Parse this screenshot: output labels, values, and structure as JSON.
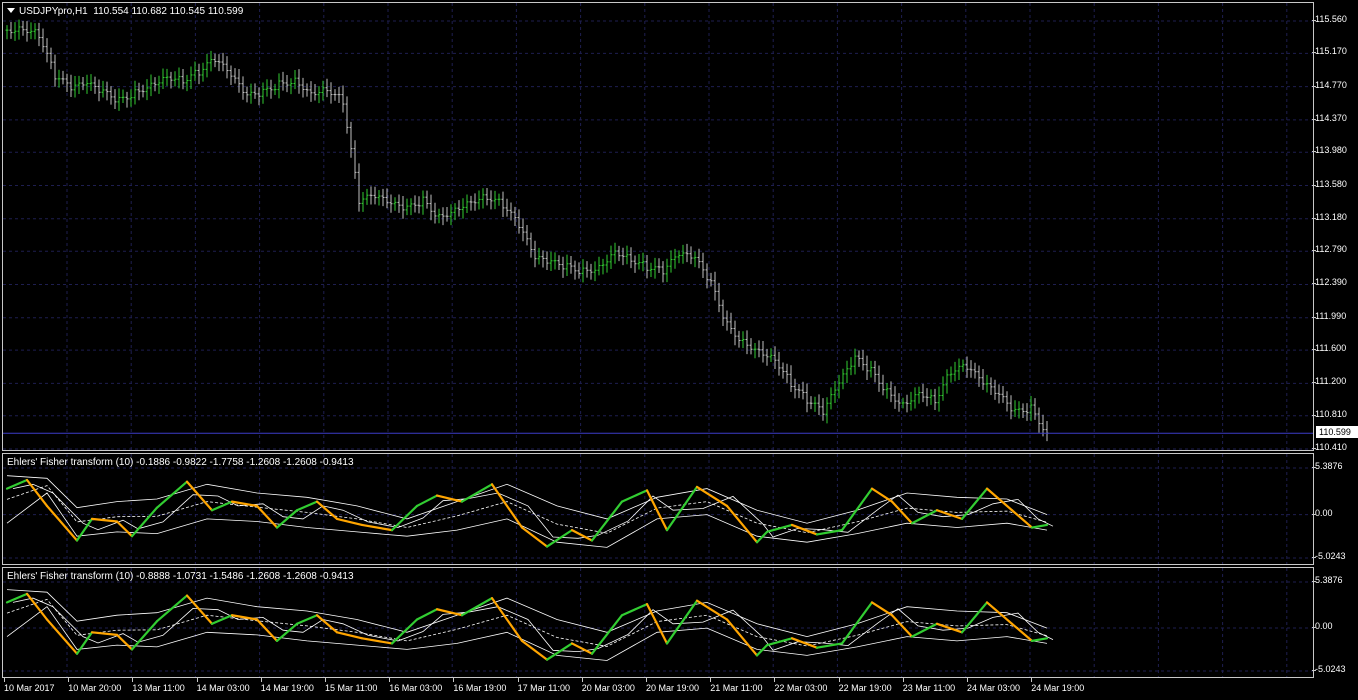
{
  "main_pane": {
    "title": "USDJPYpro,H1",
    "ohlc": "110.554 110.682 110.545 110.599",
    "price_ticks": [
      "115.560",
      "115.170",
      "114.770",
      "114.370",
      "113.980",
      "113.580",
      "113.180",
      "112.790",
      "112.390",
      "111.990",
      "111.600",
      "111.200",
      "110.810",
      "110.410"
    ],
    "current_price": "110.599",
    "colors": {
      "bull": "#32cd32",
      "bear": "#c0c0c0",
      "grid": "#1e1e50",
      "current_line": "#3c3cc8"
    }
  },
  "indicator_1": {
    "title": "Ehlers' Fisher transform (10) -0.1886 -0.9822 -1.7758 -1.2608 -1.2608 -0.9413",
    "scale": [
      "5.3876",
      "0.00",
      "-5.0243"
    ],
    "colors": {
      "rising": "#32cd32",
      "falling": "#ffa500",
      "bands": "#ffffff"
    }
  },
  "indicator_2": {
    "title": "Ehlers' Fisher transform (10) -0.8888 -1.0731 -1.5486 -1.2608 -1.2608 -0.9413",
    "scale": [
      "5.3876",
      "0.00",
      "-5.0243"
    ],
    "colors": {
      "rising": "#32cd32",
      "falling": "#ffa500",
      "bands": "#ffffff"
    }
  },
  "time_axis": {
    "labels": [
      "10 Mar 2017",
      "10 Mar 20:00",
      "13 Mar 11:00",
      "14 Mar 03:00",
      "14 Mar 19:00",
      "15 Mar 11:00",
      "16 Mar 03:00",
      "16 Mar 19:00",
      "17 Mar 11:00",
      "20 Mar 03:00",
      "20 Mar 19:00",
      "21 Mar 11:00",
      "22 Mar 03:00",
      "22 Mar 19:00",
      "23 Mar 11:00",
      "24 Mar 03:00",
      "24 Mar 19:00"
    ]
  },
  "chart_data": [
    {
      "type": "line",
      "title": "USDJPYpro,H1",
      "ylim": [
        110.41,
        115.56
      ],
      "series": [
        {
          "name": "USDJPYpro,H1",
          "x": [
            0,
            16,
            32,
            48,
            64,
            80,
            96,
            112,
            128,
            144,
            160,
            176,
            192,
            208,
            224,
            240,
            256,
            272,
            288,
            304,
            320,
            336,
            352,
            368,
            384,
            400,
            416,
            432,
            448,
            464,
            480,
            496,
            512,
            528,
            544,
            560,
            576,
            592,
            608,
            624,
            640,
            656,
            672,
            688,
            704,
            720,
            736,
            752,
            768,
            784,
            800,
            816,
            832,
            848,
            864,
            880,
            896,
            912,
            928,
            944,
            960,
            976,
            992,
            1008,
            1024,
            1040
          ],
          "values": [
            115.45,
            115.48,
            115.4,
            114.9,
            114.75,
            114.8,
            114.7,
            114.6,
            114.7,
            114.8,
            114.9,
            114.85,
            114.95,
            115.1,
            114.9,
            114.65,
            114.7,
            114.8,
            114.85,
            114.7,
            114.75,
            114.6,
            113.4,
            113.45,
            113.35,
            113.3,
            113.4,
            113.2,
            113.3,
            113.4,
            113.45,
            113.35,
            113.1,
            112.7,
            112.65,
            112.6,
            112.55,
            112.6,
            112.8,
            112.7,
            112.6,
            112.55,
            112.75,
            112.7,
            112.4,
            111.9,
            111.7,
            111.6,
            111.5,
            111.2,
            111.0,
            110.85,
            111.2,
            111.5,
            111.35,
            111.1,
            110.95,
            111.1,
            111.0,
            111.35,
            111.4,
            111.2,
            111.05,
            110.85,
            110.9,
            110.6
          ]
        }
      ]
    },
    {
      "type": "line",
      "title": "Ehlers' Fisher transform (10) -0.1886 -0.9822 -1.7758 -1.2608 -1.2608 -0.9413",
      "ylim": [
        -5.0243,
        5.3876
      ],
      "series": [
        {
          "x": [
            0,
            20,
            40,
            70,
            85,
            110,
            125,
            150,
            180,
            205,
            225,
            250,
            270,
            290,
            310,
            330,
            355,
            385,
            410,
            430,
            455,
            485,
            515,
            540,
            565,
            585,
            615,
            640,
            660,
            690,
            720,
            750,
            760,
            785,
            810,
            835,
            865,
            885,
            905,
            930,
            955,
            980,
            1005,
            1025,
            1040
          ],
          "values": [
            3.0,
            4.0,
            1.0,
            -3.0,
            -0.5,
            -0.8,
            -2.5,
            0.8,
            3.8,
            0.5,
            1.5,
            1.0,
            -1.5,
            0.5,
            1.5,
            -0.5,
            -1.2,
            -1.8,
            1.0,
            2.2,
            1.5,
            3.5,
            -1.5,
            -3.7,
            -1.8,
            -3.0,
            1.5,
            2.8,
            -1.8,
            3.2,
            1.0,
            -3.2,
            -2.0,
            -1.2,
            -2.3,
            -1.8,
            3.0,
            1.5,
            -1.0,
            0.5,
            -0.5,
            3.0,
            0.5,
            -1.5,
            -1.2
          ]
        },
        {
          "x": [
            0,
            40,
            70,
            110,
            150,
            200,
            250,
            300,
            350,
            400,
            450,
            500,
            550,
            600,
            650,
            700,
            750,
            800,
            850,
            900,
            950,
            1000,
            1040
          ],
          "values": [
            4.5,
            4.2,
            0.8,
            1.5,
            1.8,
            3.5,
            2.5,
            2.0,
            1.0,
            -0.5,
            1.5,
            3.5,
            1.0,
            -0.5,
            2.0,
            3.0,
            0.5,
            -1.0,
            0.5,
            2.5,
            2.0,
            1.8,
            0.0
          ]
        },
        {
          "x": [
            0,
            40,
            70,
            110,
            150,
            200,
            250,
            300,
            350,
            400,
            450,
            500,
            550,
            600,
            650,
            700,
            750,
            800,
            850,
            900,
            950,
            1000,
            1040
          ],
          "values": [
            -1.0,
            2.5,
            -2.5,
            -2.0,
            -2.2,
            -0.5,
            -0.8,
            -1.5,
            -2.0,
            -2.5,
            -1.8,
            -0.5,
            -3.2,
            -3.8,
            -0.5,
            0.0,
            -2.5,
            -3.2,
            -2.2,
            -1.0,
            -1.5,
            -1.0,
            -1.8
          ]
        }
      ]
    },
    {
      "type": "line",
      "title": "Ehlers' Fisher transform (10) -0.8888 -1.0731 -1.5486 -1.2608 -1.2608 -0.9413",
      "ylim": [
        -5.0243,
        5.3876
      ],
      "series": [
        {
          "x": [
            0,
            20,
            40,
            70,
            85,
            110,
            125,
            150,
            180,
            205,
            225,
            250,
            270,
            290,
            310,
            330,
            355,
            385,
            410,
            430,
            455,
            485,
            515,
            540,
            565,
            585,
            615,
            640,
            660,
            690,
            720,
            750,
            760,
            785,
            810,
            835,
            865,
            885,
            905,
            930,
            955,
            980,
            1005,
            1025,
            1040
          ],
          "values": [
            3.0,
            4.0,
            1.0,
            -3.0,
            -0.5,
            -0.8,
            -2.5,
            0.8,
            3.8,
            0.5,
            1.5,
            1.0,
            -1.5,
            0.5,
            1.5,
            -0.5,
            -1.2,
            -1.8,
            1.0,
            2.2,
            1.5,
            3.5,
            -1.5,
            -3.7,
            -1.8,
            -3.0,
            1.5,
            2.8,
            -1.8,
            3.2,
            1.0,
            -3.2,
            -2.0,
            -1.2,
            -2.3,
            -1.8,
            3.0,
            1.5,
            -1.0,
            0.5,
            -0.5,
            3.0,
            0.5,
            -1.5,
            -1.2
          ]
        },
        {
          "x": [
            0,
            40,
            70,
            110,
            150,
            200,
            250,
            300,
            350,
            400,
            450,
            500,
            550,
            600,
            650,
            700,
            750,
            800,
            850,
            900,
            950,
            1000,
            1040
          ],
          "values": [
            4.5,
            4.2,
            0.8,
            1.5,
            1.8,
            3.5,
            2.5,
            2.0,
            1.0,
            -0.5,
            1.5,
            3.5,
            1.0,
            -0.5,
            2.0,
            3.0,
            0.5,
            -1.0,
            0.5,
            2.5,
            2.0,
            1.8,
            0.0
          ]
        },
        {
          "x": [
            0,
            40,
            70,
            110,
            150,
            200,
            250,
            300,
            350,
            400,
            450,
            500,
            550,
            600,
            650,
            700,
            750,
            800,
            850,
            900,
            950,
            1000,
            1040
          ],
          "values": [
            -1.0,
            2.5,
            -2.5,
            -2.0,
            -2.2,
            -0.5,
            -0.8,
            -1.5,
            -2.0,
            -2.5,
            -1.8,
            -0.5,
            -3.2,
            -3.8,
            -0.5,
            0.0,
            -2.5,
            -3.2,
            -2.2,
            -1.0,
            -1.5,
            -1.0,
            -1.8
          ]
        }
      ]
    }
  ]
}
